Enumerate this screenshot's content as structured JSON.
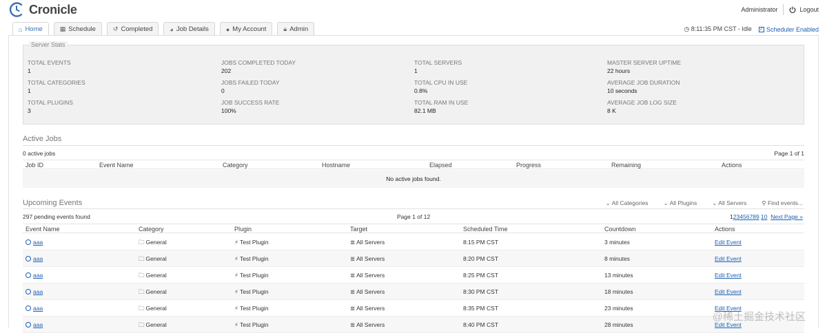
{
  "app": {
    "name": "Cronicle"
  },
  "header": {
    "user": "Administrator",
    "logout": "Logout"
  },
  "tabs": [
    {
      "label": "Home",
      "icon": "home-icon"
    },
    {
      "label": "Schedule",
      "icon": "calendar-icon"
    },
    {
      "label": "Completed",
      "icon": "history-icon"
    },
    {
      "label": "Job Details",
      "icon": "pie-chart-icon"
    },
    {
      "label": "My Account",
      "icon": "user-icon"
    },
    {
      "label": "Admin",
      "icon": "lock-icon"
    }
  ],
  "status": {
    "clock": "8:11:35 PM CST - Idle",
    "scheduler": "Scheduler Enabled"
  },
  "server_stats": {
    "legend": "Server Stats",
    "items": [
      {
        "label": "TOTAL EVENTS",
        "value": "1"
      },
      {
        "label": "JOBS COMPLETED TODAY",
        "value": "202"
      },
      {
        "label": "TOTAL SERVERS",
        "value": "1"
      },
      {
        "label": "MASTER SERVER UPTIME",
        "value": "22 hours"
      },
      {
        "label": "TOTAL CATEGORIES",
        "value": "1"
      },
      {
        "label": "JOBS FAILED TODAY",
        "value": "0"
      },
      {
        "label": "TOTAL CPU IN USE",
        "value": "0.8%"
      },
      {
        "label": "AVERAGE JOB DURATION",
        "value": "10 seconds"
      },
      {
        "label": "TOTAL PLUGINS",
        "value": "3"
      },
      {
        "label": "JOB SUCCESS RATE",
        "value": "100%"
      },
      {
        "label": "TOTAL RAM IN USE",
        "value": "82.1 MB"
      },
      {
        "label": "AVERAGE JOB LOG SIZE",
        "value": "8 K"
      }
    ]
  },
  "active_jobs": {
    "title": "Active Jobs",
    "count": "0 active jobs",
    "page": "Page 1 of 1",
    "columns": [
      "Job ID",
      "Event Name",
      "Category",
      "Hostname",
      "Elapsed",
      "Progress",
      "Remaining",
      "Actions"
    ],
    "empty": "No active jobs found."
  },
  "upcoming": {
    "title": "Upcoming Events",
    "filters": [
      "All Categories",
      "All Plugins",
      "All Servers",
      "Find events..."
    ],
    "count": "297 pending events found",
    "page": "Page 1 of 12",
    "pages": [
      "1",
      "2",
      "3",
      "4",
      "5",
      "6",
      "7",
      "8",
      "9",
      "10"
    ],
    "next": "Next Page »",
    "columns": [
      "Event Name",
      "Category",
      "Plugin",
      "Target",
      "Scheduled Time",
      "Countdown",
      "Actions"
    ],
    "rows": [
      {
        "name": "aaa",
        "category": "General",
        "plugin": "Test Plugin",
        "target": "All Servers",
        "time": "8:15 PM CST",
        "countdown": "3 minutes",
        "action": "Edit Event"
      },
      {
        "name": "aaa",
        "category": "General",
        "plugin": "Test Plugin",
        "target": "All Servers",
        "time": "8:20 PM CST",
        "countdown": "8 minutes",
        "action": "Edit Event"
      },
      {
        "name": "aaa",
        "category": "General",
        "plugin": "Test Plugin",
        "target": "All Servers",
        "time": "8:25 PM CST",
        "countdown": "13 minutes",
        "action": "Edit Event"
      },
      {
        "name": "aaa",
        "category": "General",
        "plugin": "Test Plugin",
        "target": "All Servers",
        "time": "8:30 PM CST",
        "countdown": "18 minutes",
        "action": "Edit Event"
      },
      {
        "name": "aaa",
        "category": "General",
        "plugin": "Test Plugin",
        "target": "All Servers",
        "time": "8:35 PM CST",
        "countdown": "23 minutes",
        "action": "Edit Event"
      },
      {
        "name": "aaa",
        "category": "General",
        "plugin": "Test Plugin",
        "target": "All Servers",
        "time": "8:40 PM CST",
        "countdown": "28 minutes",
        "action": "Edit Event"
      }
    ]
  },
  "watermark": "@稀土掘金技术社区"
}
